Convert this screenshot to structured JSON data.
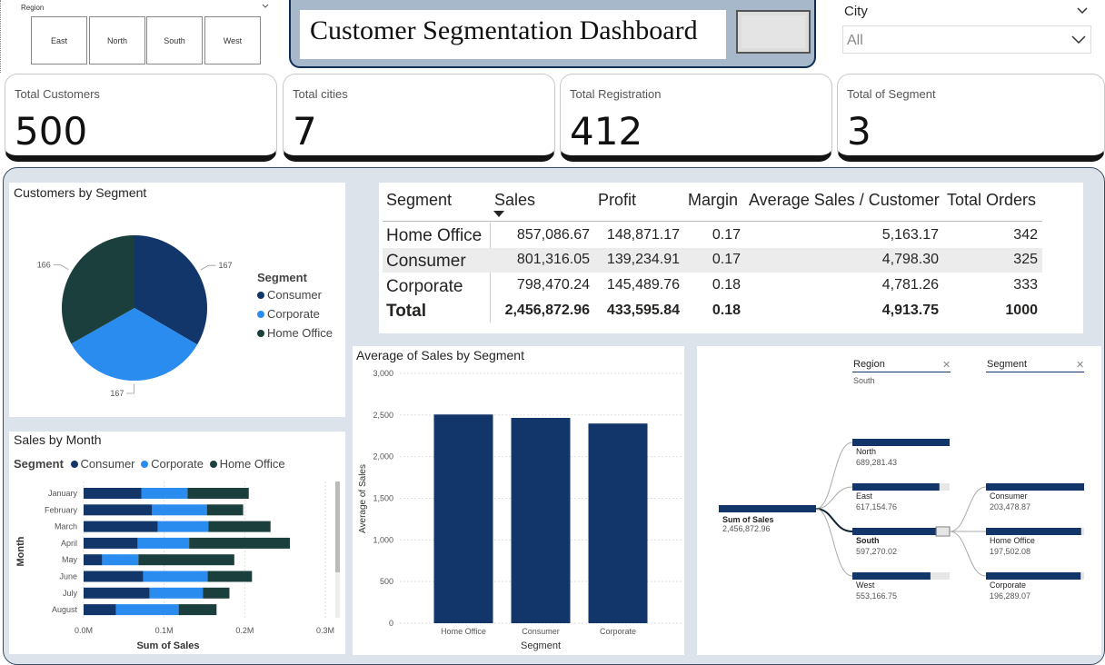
{
  "region_slicer": {
    "label": "Region",
    "options": [
      "East",
      "North",
      "South",
      "West"
    ]
  },
  "title": {
    "text": "Customer Segmentation Dashboard"
  },
  "city_slicer": {
    "label": "City",
    "value": "All"
  },
  "kpis": [
    {
      "title": "Total Customers",
      "value": "500"
    },
    {
      "title": "Total cities",
      "value": "7"
    },
    {
      "title": "Total Registration",
      "value": "412"
    },
    {
      "title": "Total of Segment",
      "value": "3"
    }
  ],
  "colors": {
    "consumer": "#12366a",
    "corporate": "#2b8cf0",
    "home_office": "#1b3f3c",
    "dark_border": "#141414",
    "panel_bg": "#dde3ea"
  },
  "pie_card": {
    "title": "Customers by Segment",
    "legend_title": "Segment",
    "labels": [
      "167",
      "167",
      "166"
    ]
  },
  "table": {
    "headers": [
      "Segment",
      "Sales",
      "Profit",
      "Margin",
      "Average Sales / Customer",
      "Total Orders"
    ],
    "rows": [
      [
        "Home Office",
        "857,086.67",
        "148,871.17",
        "0.17",
        "5,163.17",
        "342"
      ],
      [
        "Consumer",
        "801,316.05",
        "139,234.91",
        "0.17",
        "4,798.30",
        "325"
      ],
      [
        "Corporate",
        "798,470.24",
        "145,489.76",
        "0.18",
        "4,781.26",
        "333"
      ]
    ],
    "total": [
      "Total",
      "2,456,872.96",
      "433,595.84",
      "0.18",
      "4,913.75",
      "1000"
    ]
  },
  "month_card": {
    "title": "Sales by Month",
    "legend_title": "Segment",
    "xlabel": "Sum of Sales",
    "ylabel": "Month",
    "xticks": [
      "0.0M",
      "0.1M",
      "0.2M",
      "0.3M"
    ]
  },
  "avg_card": {
    "title": "Average of Sales by Segment",
    "xlabel": "Segment",
    "ylabel": "Average of Sales"
  },
  "decomp": {
    "headers": [
      "Region",
      "Segment"
    ],
    "region_filter": "South",
    "root": {
      "label": "Sum of Sales",
      "value": "2,456,872.96"
    },
    "regions": [
      {
        "label": "North",
        "value": "689,281.43",
        "fill": 1.0
      },
      {
        "label": "East",
        "value": "617,154.76",
        "fill": 0.895
      },
      {
        "label": "South",
        "value": "597,270.02",
        "fill": 0.866
      },
      {
        "label": "West",
        "value": "553,166.75",
        "fill": 0.803
      }
    ],
    "segments": [
      {
        "label": "Consumer",
        "value": "203,478.87",
        "fill": 1.0
      },
      {
        "label": "Home Office",
        "value": "197,502.08",
        "fill": 0.97
      },
      {
        "label": "Corporate",
        "value": "196,289.07",
        "fill": 0.965
      }
    ]
  },
  "chart_data": [
    {
      "type": "pie",
      "title": "Customers by Segment",
      "categories": [
        "Consumer",
        "Corporate",
        "Home Office"
      ],
      "values": [
        167,
        167,
        166
      ],
      "legend": "right"
    },
    {
      "type": "bar",
      "orientation": "horizontal",
      "stacked": true,
      "title": "Sales by Month",
      "categories": [
        "January",
        "February",
        "March",
        "April",
        "May",
        "June",
        "July",
        "August"
      ],
      "series": [
        {
          "name": "Consumer",
          "values": [
            72000,
            85000,
            92000,
            67000,
            23000,
            74000,
            82000,
            40000
          ]
        },
        {
          "name": "Corporate",
          "values": [
            57000,
            68000,
            63000,
            64000,
            45000,
            80000,
            66000,
            78000
          ]
        },
        {
          "name": "Home Office",
          "values": [
            76000,
            45000,
            77000,
            125000,
            119000,
            55000,
            33000,
            47000
          ]
        }
      ],
      "xlim": [
        0,
        300000
      ],
      "xlabel": "Sum of Sales",
      "ylabel": "Month",
      "legend": "top"
    },
    {
      "type": "bar",
      "title": "Average of Sales by Segment",
      "categories": [
        "Home Office",
        "Consumer",
        "Corporate"
      ],
      "values": [
        2506.31,
        2465.59,
        2397.81
      ],
      "ylim": [
        0,
        3000
      ],
      "yticks": [
        "0",
        "500",
        "1,000",
        "1,500",
        "2,000",
        "2,500",
        "3,000"
      ],
      "xlabel": "Segment",
      "ylabel": "Average of Sales",
      "grid": true
    }
  ]
}
